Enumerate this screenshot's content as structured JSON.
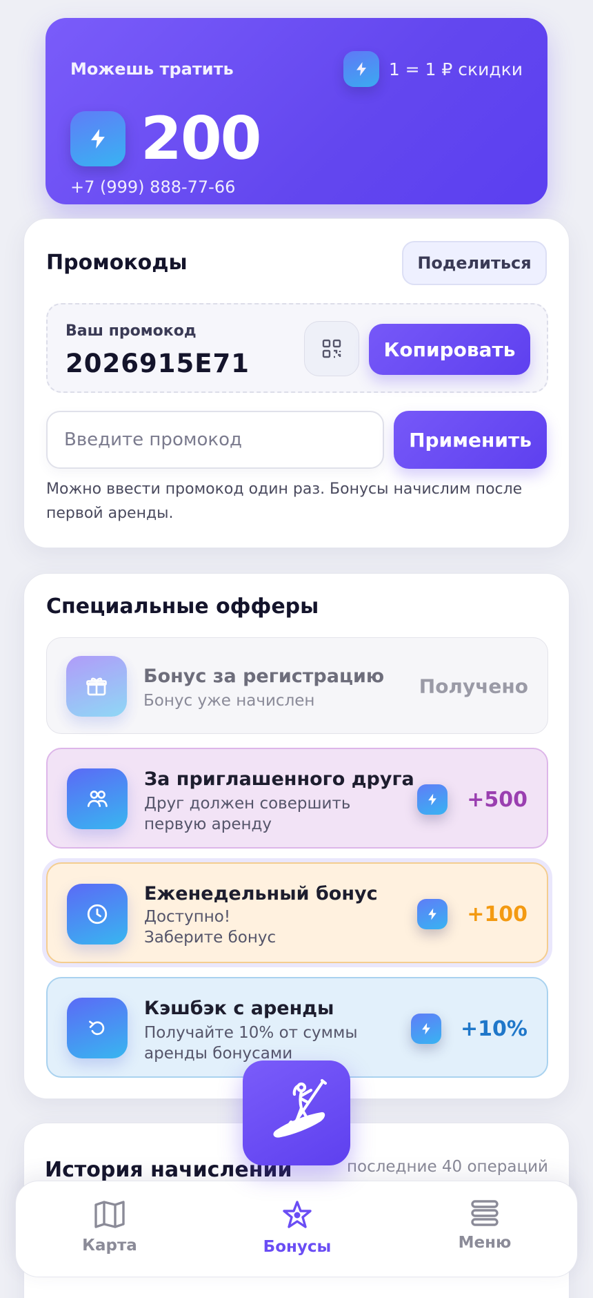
{
  "balance": {
    "label": "Можешь тратить",
    "rate": "1 = 1 ₽ скидки",
    "amount": "200",
    "phone": "+7 (999) 888-77-66"
  },
  "promo": {
    "title": "Промокоды",
    "share_label": "Поделиться",
    "your_code_caption": "Ваш промокод",
    "code": "2026915E71",
    "copy_label": "Копировать",
    "input_placeholder": "Введите промокод",
    "input_value": "",
    "apply_label": "Применить",
    "hint": "Можно ввести промокод один раз. Бонусы начислим после первой аренды."
  },
  "offers": {
    "title": "Специальные офферы",
    "items": [
      {
        "icon": "gift-icon",
        "title": "Бонус за регистрацию",
        "subtitle": "Бонус уже начислен",
        "status": "Получено"
      },
      {
        "icon": "users-icon",
        "title": "За приглашенного друга",
        "subtitle": "Друг должен совершить первую аренду",
        "reward": "+500",
        "reward_color": "#9a3fb0"
      },
      {
        "icon": "clock-icon",
        "title": "Еженедельный бонус",
        "subtitle": "Доступно!\nЗаберите бонус",
        "reward": "+100",
        "reward_color": "#f39a12"
      },
      {
        "icon": "rotate-ccw-icon",
        "title": "Кэшбэк с аренды",
        "subtitle": "Получайте 10% от суммы аренды бонусами",
        "reward": "+10%",
        "reward_color": "#1f77c9"
      }
    ]
  },
  "history": {
    "title": "История начислений",
    "subtitle": "последние 40 операций"
  },
  "nav": {
    "items": [
      {
        "icon": "map-icon",
        "label": "Карта",
        "active": false
      },
      {
        "icon": "star-icon",
        "label": "Бонусы",
        "active": true
      },
      {
        "icon": "menu-icon",
        "label": "Меню",
        "active": false
      }
    ],
    "center_icon": "paddleboard-icon"
  },
  "colors": {
    "accent": "#6347ef",
    "accent_light": "#7a5cfa",
    "nav_active": "#6a4df4",
    "nav_inactive": "#8b8b98"
  }
}
